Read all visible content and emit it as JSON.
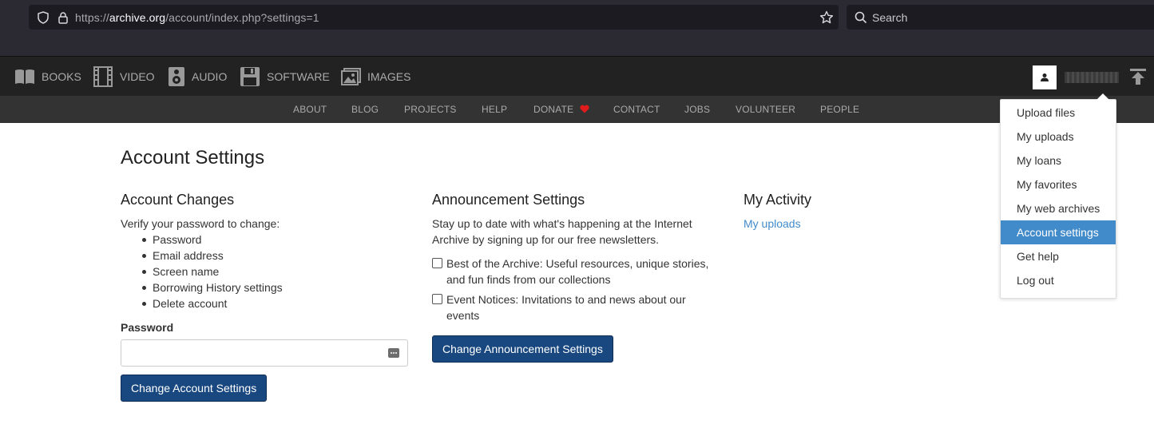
{
  "browser": {
    "url_prefix": "https://",
    "url_host": "archive.org",
    "url_path": "/account/index.php?settings=1",
    "search_placeholder": "Search"
  },
  "media_nav": [
    {
      "label": "BOOKS",
      "icon": "book-icon"
    },
    {
      "label": "VIDEO",
      "icon": "film-icon"
    },
    {
      "label": "AUDIO",
      "icon": "speaker-icon"
    },
    {
      "label": "SOFTWARE",
      "icon": "floppy-icon"
    },
    {
      "label": "IMAGES",
      "icon": "image-icon"
    }
  ],
  "sub_nav": [
    "ABOUT",
    "BLOG",
    "PROJECTS",
    "HELP",
    "DONATE",
    "CONTACT",
    "JOBS",
    "VOLUNTEER",
    "PEOPLE"
  ],
  "user_menu": {
    "items": [
      "Upload files",
      "My uploads",
      "My loans",
      "My favorites",
      "My web archives",
      "Account settings",
      "Get help",
      "Log out"
    ],
    "active": "Account settings"
  },
  "page": {
    "title": "Account Settings",
    "account_changes": {
      "heading": "Account Changes",
      "intro": "Verify your password to change:",
      "bullets": [
        "Password",
        "Email address",
        "Screen name",
        "Borrowing History settings",
        "Delete account"
      ],
      "password_label": "Password",
      "button": "Change Account Settings"
    },
    "announcements": {
      "heading": "Announcement Settings",
      "intro_line1": "Stay up to date with what's happening at the Internet",
      "intro_line2": "Archive by signing up for our free newsletters.",
      "options": [
        {
          "line1": "Best of the Archive: Useful resources, unique stories,",
          "line2": "and fun finds from our collections",
          "checked": false
        },
        {
          "line1": "Event Notices: Invitations to and news about our",
          "line2": "events",
          "checked": false
        }
      ],
      "button": "Change Announcement Settings"
    },
    "activity": {
      "heading": "My Activity",
      "link": "My uploads"
    }
  },
  "colors": {
    "accent": "#428bca",
    "button": "#194880",
    "heart": "#e01b1b"
  }
}
